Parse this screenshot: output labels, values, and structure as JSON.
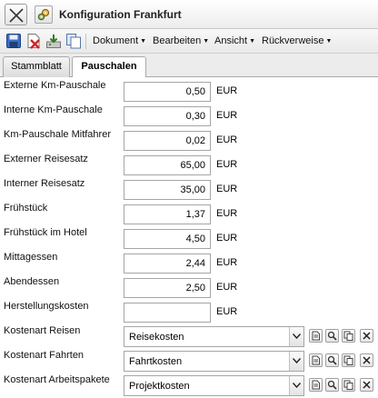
{
  "window": {
    "title": "Konfiguration Frankfurt"
  },
  "toolbar": {
    "icons": [
      "save-icon",
      "delete-icon",
      "export-icon",
      "copy-icon"
    ],
    "menus": [
      {
        "label": "Dokument"
      },
      {
        "label": "Bearbeiten"
      },
      {
        "label": "Ansicht"
      },
      {
        "label": "Rückverweise"
      }
    ]
  },
  "tabs": [
    {
      "label": "Stammblatt",
      "active": false
    },
    {
      "label": "Pauschalen",
      "active": true
    }
  ],
  "fields": [
    {
      "label": "Externe Km-Pauschale",
      "value": "0,50",
      "unit": "EUR"
    },
    {
      "label": "Interne Km-Pauschale",
      "value": "0,30",
      "unit": "EUR"
    },
    {
      "label": "Km-Pauschale Mitfahrer",
      "value": "0,02",
      "unit": "EUR"
    },
    {
      "label": "Externer Reisesatz",
      "value": "65,00",
      "unit": "EUR"
    },
    {
      "label": "Interner Reisesatz",
      "value": "35,00",
      "unit": "EUR"
    },
    {
      "label": "Frühstück",
      "value": "1,37",
      "unit": "EUR"
    },
    {
      "label": "Frühstück im Hotel",
      "value": "4,50",
      "unit": "EUR"
    },
    {
      "label": "Mittagessen",
      "value": "2,44",
      "unit": "EUR"
    },
    {
      "label": "Abendessen",
      "value": "2,50",
      "unit": "EUR"
    },
    {
      "label": "Herstellungskosten",
      "value": "",
      "unit": "EUR"
    }
  ],
  "selects": [
    {
      "label": "Kostenart Reisen",
      "value": "Reisekosten"
    },
    {
      "label": "Kostenart Fahrten",
      "value": "Fahrtkosten"
    },
    {
      "label": "Kostenart Arbeitspakete",
      "value": "Projektkosten"
    }
  ],
  "select_action_icons": [
    "new-document-icon",
    "search-icon",
    "copy-icon",
    "clear-icon"
  ]
}
